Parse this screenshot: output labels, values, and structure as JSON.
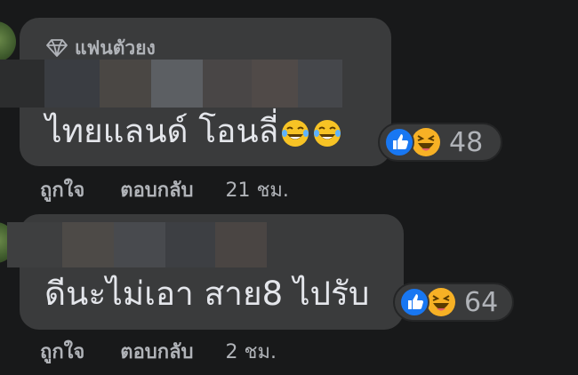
{
  "comments": [
    {
      "badge": "แฟนตัวยง",
      "text": "ไทยแลนด์ โอนลี่",
      "inline_emojis": [
        "tears-of-joy-emoji",
        "tears-of-joy-emoji"
      ],
      "reactions": {
        "icons": [
          "like-reaction-icon",
          "haha-reaction-icon"
        ],
        "count": "48"
      },
      "actions": {
        "like": "ถูกใจ",
        "reply": "ตอบกลับ",
        "time": "21 ชม."
      }
    },
    {
      "text": "ดีนะไม่เอา สาย8 ไปรับ",
      "reactions": {
        "icons": [
          "like-reaction-icon",
          "haha-reaction-icon"
        ],
        "count": "64"
      },
      "actions": {
        "like": "ถูกใจ",
        "reply": "ตอบกลับ",
        "time": "2 ชม."
      }
    }
  ],
  "colors": {
    "background": "#18191a",
    "bubble": "#3a3b3c",
    "primary_text": "#e4e6eb",
    "secondary_text": "#b0b3b8",
    "like_blue": "#1877f2",
    "haha_yellow": "#f7b125"
  }
}
